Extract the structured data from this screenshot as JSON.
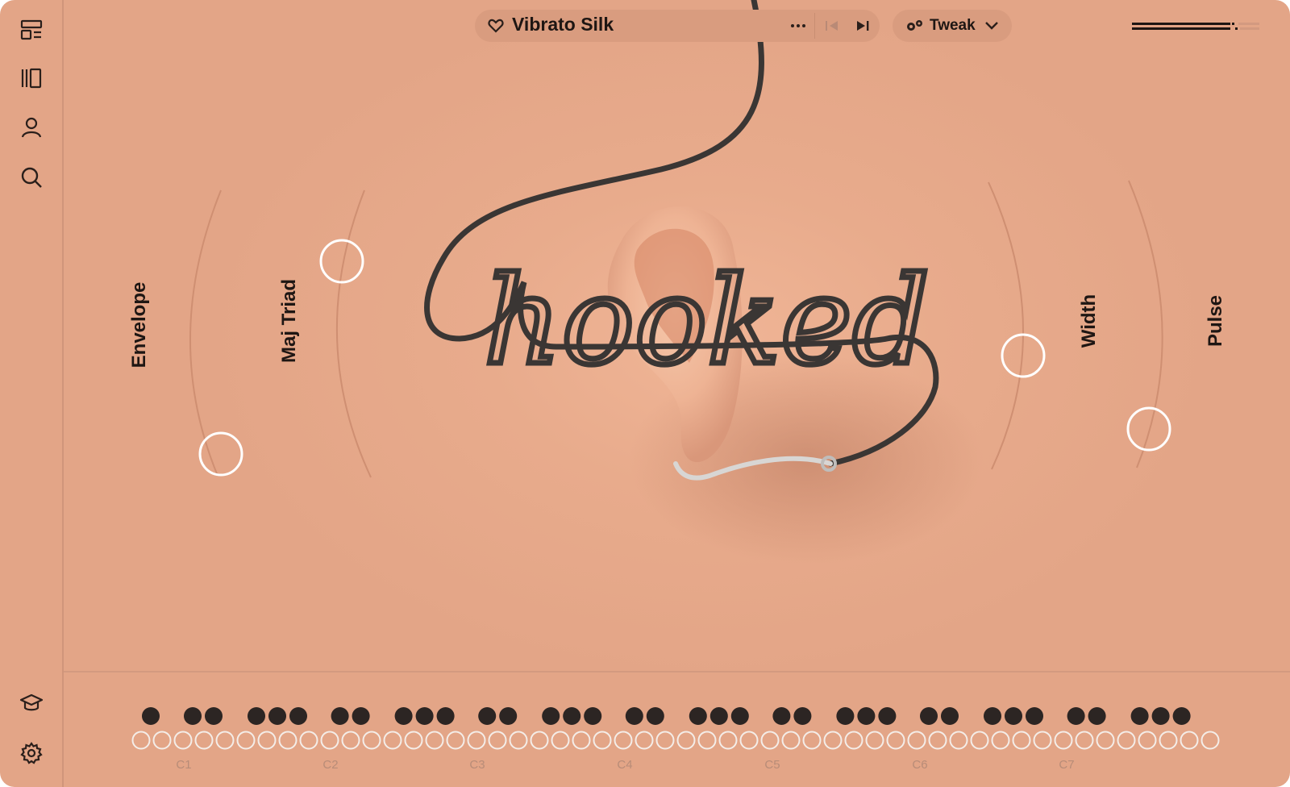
{
  "preset": {
    "name": "Vibrato Silk"
  },
  "tweak": {
    "label": "Tweak"
  },
  "macros": [
    {
      "label": "Envelope",
      "value": 0.2
    },
    {
      "label": "Maj Triad",
      "value": 0.75
    },
    {
      "label": "Width",
      "value": 0.45
    },
    {
      "label": "Pulse",
      "value": 0.3
    }
  ],
  "logo": {
    "text": "hooked"
  },
  "keyboard": {
    "octave_labels": [
      "C1",
      "C2",
      "C3",
      "C4",
      "C5",
      "C6",
      "C7"
    ]
  },
  "icons": {
    "sidebar_top": [
      "layout-icon",
      "library-icon",
      "user-icon",
      "search-icon"
    ],
    "sidebar_bottom": [
      "learn-icon",
      "settings-icon"
    ]
  },
  "colors": {
    "background": "#e3a587",
    "ink": "#1e1613",
    "ring": "#ffffff"
  }
}
